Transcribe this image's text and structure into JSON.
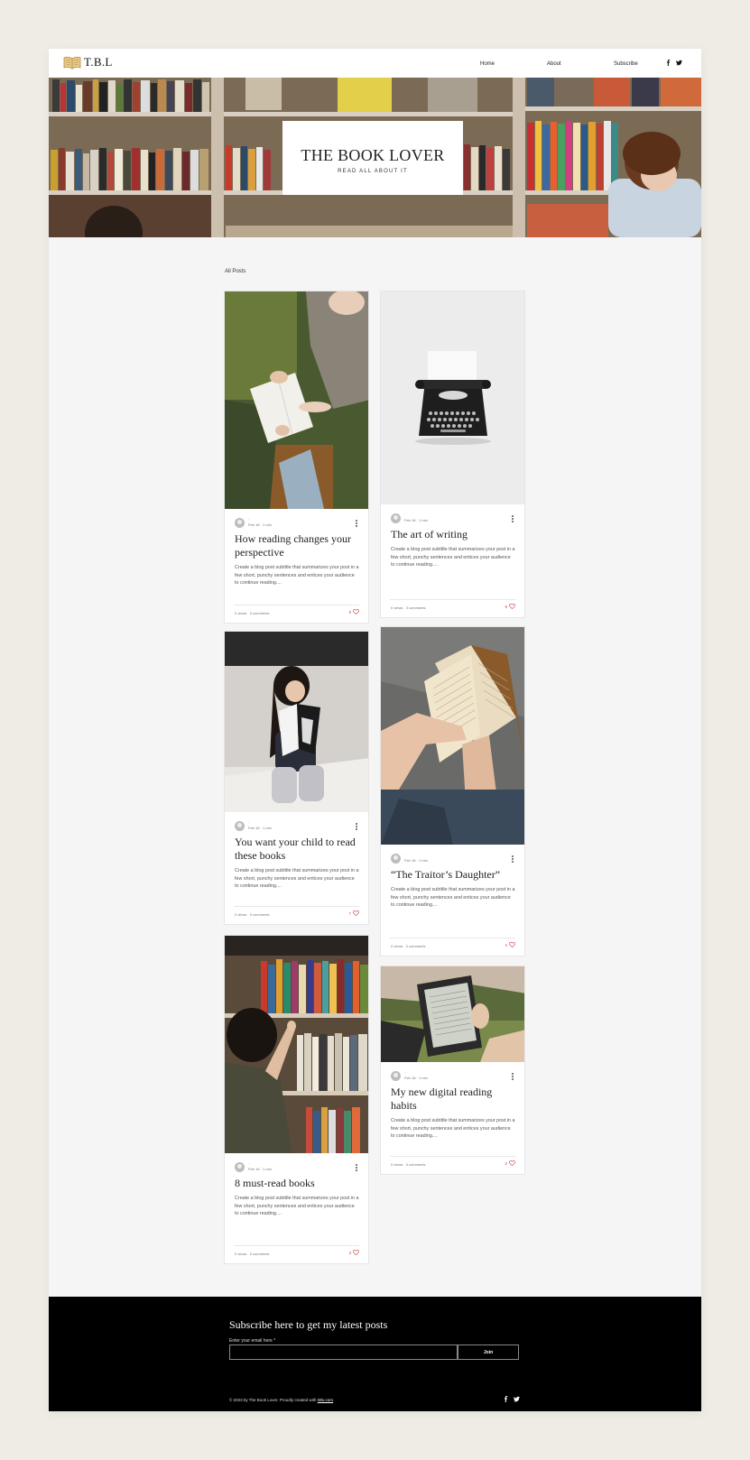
{
  "header": {
    "logo_text": "T.B.L",
    "nav": [
      "Home",
      "About",
      "Subscribe"
    ],
    "social": [
      "facebook-icon",
      "twitter-icon"
    ]
  },
  "hero": {
    "title": "THE BOOK LOVER",
    "subtitle": "READ ALL ABOUT IT"
  },
  "blog": {
    "all_posts_label": "All Posts",
    "posts": [
      {
        "title": "How reading changes your perspective",
        "date": "Feb 18",
        "read": "1 min",
        "excerpt": "Create a blog post subtitle that summarizes your post in a few short, punchy sentences and entices your audience to continue reading....",
        "views": "0 views",
        "comments": "0 comments",
        "likes": "5",
        "image": "hands-passing-book-photo"
      },
      {
        "title": "The art of writing",
        "date": "Feb 18",
        "read": "1 min",
        "excerpt": "Create a blog post subtitle that summarizes your post in a few short, punchy sentences and entices your audience to continue reading....",
        "views": "0 views",
        "comments": "0 comments",
        "likes": "9",
        "image": "typewriter-photo"
      },
      {
        "title": "You want your child to read these books",
        "date": "Feb 18",
        "read": "1 min",
        "excerpt": "Create a blog post subtitle that summarizes your post in a few short, punchy sentences and entices your audience to continue reading....",
        "views": "0 views",
        "comments": "0 comments",
        "likes": "7",
        "image": "child-reading-photo"
      },
      {
        "title": "“The Traitor’s Daughter”",
        "date": "Feb 18",
        "read": "1 min",
        "excerpt": "Create a blog post subtitle that summarizes your post in a few short, punchy sentences and entices your audience to continue reading....",
        "views": "0 views",
        "comments": "0 comments",
        "likes": "4",
        "image": "open-book-photo"
      },
      {
        "title": "8 must-read books",
        "date": "Feb 18",
        "read": "1 min",
        "excerpt": "Create a blog post subtitle that summarizes your post in a few short, punchy sentences and entices your audience to continue reading....",
        "views": "0 views",
        "comments": "0 comments",
        "likes": "3",
        "image": "bookshelf-photo"
      },
      {
        "title": "My new digital reading habits",
        "date": "Feb 18",
        "read": "1 min",
        "excerpt": "Create a blog post subtitle that summarizes your post in a few short, punchy sentences and entices your audience to continue reading....",
        "views": "0 views",
        "comments": "0 comments",
        "likes": "2",
        "image": "ereader-photo"
      }
    ]
  },
  "footer": {
    "subscribe_title": "Subscribe here to get my latest posts",
    "email_label": "Enter your email here *",
    "join_label": "Join",
    "copyright": "© 2023 by The Book Lover. Proudly created with ",
    "wix_link": "Wix.com"
  },
  "colors": {
    "accent_like": "#cc4444",
    "footer_bg": "#000000",
    "page_bg": "#efebe5"
  }
}
